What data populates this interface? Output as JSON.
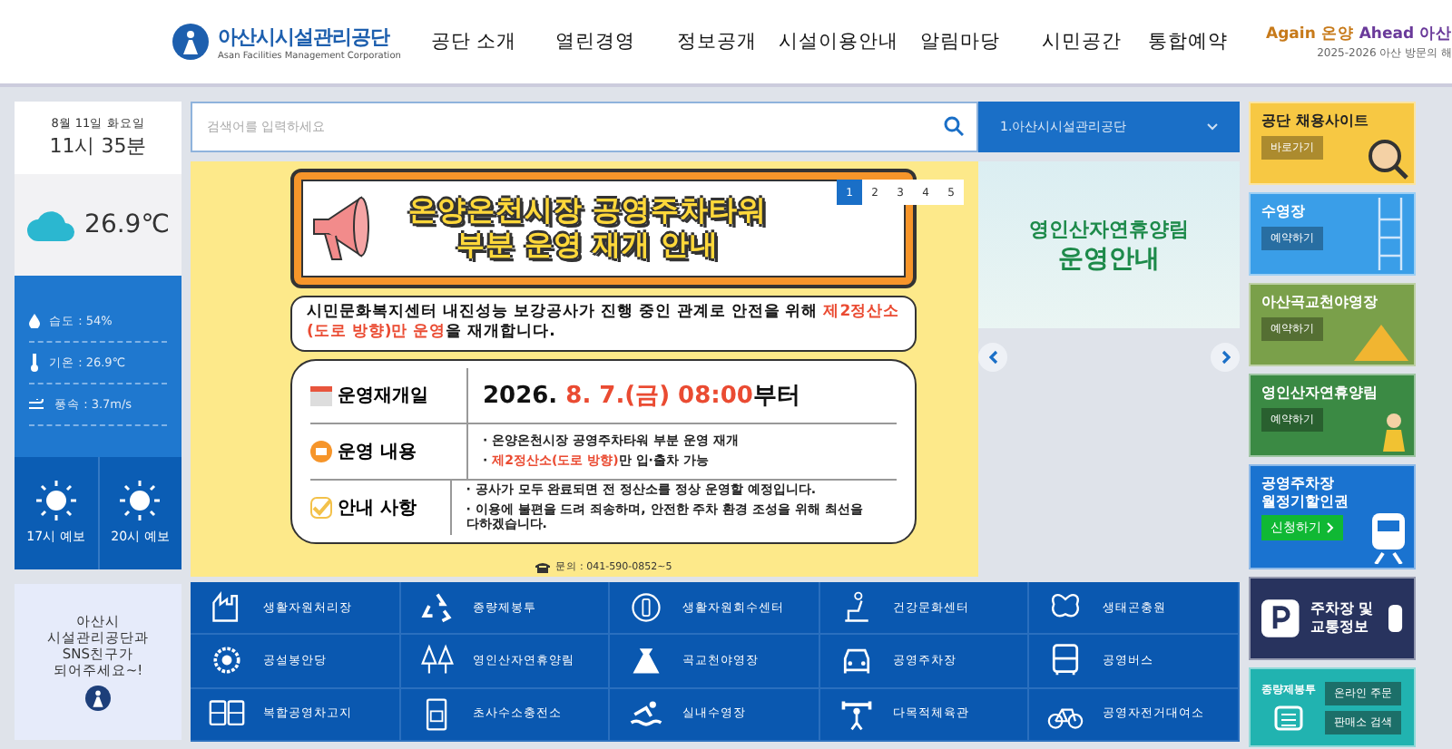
{
  "header": {
    "logo_name": "아산시시설관리공단",
    "logo_subtitle": "Asan Facilities Management Corporation",
    "nav": [
      {
        "label": "공단 소개"
      },
      {
        "label": "열린경영"
      },
      {
        "label": "정보공개"
      },
      {
        "label": "시설이용안내"
      },
      {
        "label": "알림마당"
      },
      {
        "label": "시민공간"
      },
      {
        "label": "통합예약"
      }
    ],
    "slogan_part_1": "Again 온양",
    "slogan_part_2": "Ahead 아산",
    "slogan_caption": "2025-2026 아산 방문의 해"
  },
  "weather": {
    "date": "8월 11일 화요일",
    "time": "11시 35분",
    "temperature": "26.9℃",
    "details": [
      {
        "kind": "humidity",
        "text": "습도 : 54%"
      },
      {
        "kind": "temperature",
        "text": "기온 : 26.9℃"
      },
      {
        "kind": "wind",
        "text": "풍속 : 3.7m/s"
      }
    ],
    "forecasts": [
      {
        "label": "17시 예보"
      },
      {
        "label": "20시 예보"
      }
    ]
  },
  "sns": {
    "text": "아산시 시설관리공단과 SNS친구가 되어주세요~!"
  },
  "search": {
    "placeholder": "검색어를 입력하세요",
    "site_select": "1.아산시시설관리공단"
  },
  "poster": {
    "title_line_1": "온양온천시장 공영주차타워",
    "title_line_2": "부분 운영 재개 안내",
    "notice": "시민문화복지센터 내진성능 보강공사가 진행 중인 관계로 안전을 위해 **제2정산소(도로 방향)만 운영**을 재개합니다.",
    "rows": [
      {
        "kind": "date",
        "label": "운영재개일",
        "lines": [
          "2026. **8. 7.(금) 08:00**부터"
        ]
      },
      {
        "kind": "content",
        "label": "운영 내용",
        "lines": [
          "· 온양온천시장 공영주차타워 부분 운영 재개",
          "· **제2정산소(도로 방향)**만 입·출차 가능"
        ]
      },
      {
        "kind": "notice",
        "label": "안내 사항",
        "lines": [
          "· 공사가 모두 완료되면 전 정산소를 정상 운영할 예정입니다.",
          "· 이용에 불편을 드려 죄송하며, 안전한 주차 환경 조성을 위해 최선을 다하겠습니다."
        ]
      }
    ],
    "contact": "문의 : 041-590-0852~5"
  },
  "pager": [
    {
      "label": "1",
      "selected": true
    },
    {
      "label": "2",
      "selected": false
    },
    {
      "label": "3",
      "selected": false
    },
    {
      "label": "4",
      "selected": false
    },
    {
      "label": "5",
      "selected": false
    }
  ],
  "side_banner": {
    "title_line_1": "영인산자연휴양림",
    "title_line_2": "운영안내"
  },
  "facilities": [
    {
      "label": "생활자원처리장"
    },
    {
      "label": "종량제봉투"
    },
    {
      "label": "생활자원회수센터"
    },
    {
      "label": "건강문화센터"
    },
    {
      "label": "생태곤충원"
    },
    {
      "label": "공설봉안당"
    },
    {
      "label": "영인산자연휴양림"
    },
    {
      "label": "곡교천야영장"
    },
    {
      "label": "공영주차장"
    },
    {
      "label": "공영버스"
    },
    {
      "label": "복합공영차고지"
    },
    {
      "label": "초사수소충전소"
    },
    {
      "label": "실내수영장"
    },
    {
      "label": "다목적체육관"
    },
    {
      "label": "공영자전거대여소"
    }
  ],
  "quick_links": [
    {
      "kind": "recruit",
      "title": "공단 채용사이트",
      "buttons": [
        "바로가기"
      ]
    },
    {
      "kind": "pool",
      "title": "수영장",
      "buttons": [
        "예약하기"
      ]
    },
    {
      "kind": "camping",
      "title": "아산곡교천야영장",
      "buttons": [
        "예약하기"
      ]
    },
    {
      "kind": "forest",
      "title": "영인산자연휴양림",
      "buttons": [
        "예약하기"
      ]
    },
    {
      "kind": "parking_pass",
      "title": "공영주차장 월정기할인권",
      "buttons": [
        "신청하기"
      ]
    },
    {
      "kind": "traffic",
      "title": "주차장 및 교통정보"
    },
    {
      "kind": "bags",
      "title": "종량제봉투",
      "buttons": [
        "온라인 주문",
        "판매소 검색"
      ]
    }
  ]
}
